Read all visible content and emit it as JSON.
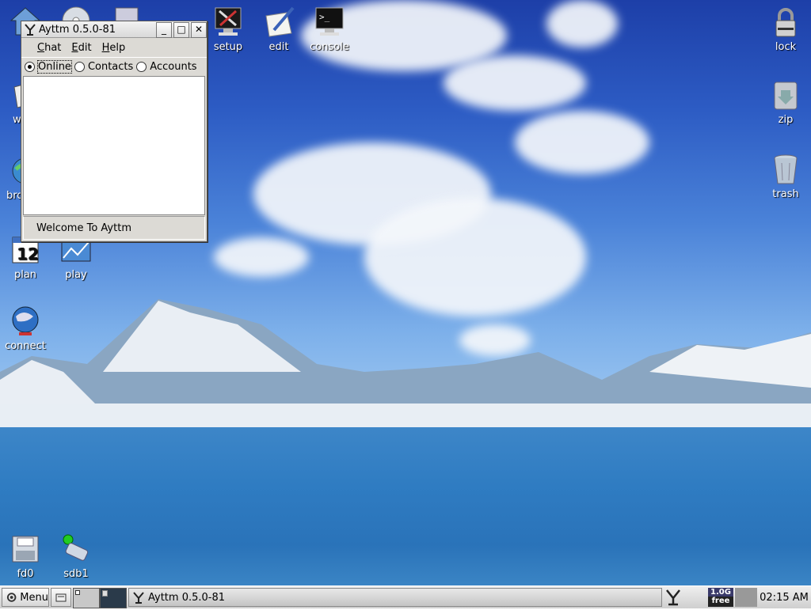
{
  "desktop": {
    "icons_top": [
      {
        "label": "setup",
        "icon": "setup-tools-icon"
      },
      {
        "label": "edit",
        "icon": "edit-pen-icon"
      },
      {
        "label": "console",
        "icon": "console-terminal-icon"
      }
    ],
    "icons_left": [
      {
        "label": "w",
        "icon": "writer-icon"
      },
      {
        "label": "bro",
        "icon": "browser-icon"
      },
      {
        "label": "plan",
        "icon": "calendar-icon",
        "badge": "12"
      },
      {
        "label": "play",
        "icon": "media-player-icon"
      },
      {
        "label": "connect",
        "icon": "network-globe-icon"
      }
    ],
    "icons_right": [
      {
        "label": "lock",
        "icon": "padlock-icon"
      },
      {
        "label": "zip",
        "icon": "archive-icon"
      },
      {
        "label": "trash",
        "icon": "trash-bin-icon"
      }
    ],
    "icons_bottom": [
      {
        "label": "fd0",
        "icon": "floppy-drive-icon"
      },
      {
        "label": "sdb1",
        "icon": "usb-drive-icon"
      }
    ]
  },
  "window": {
    "title": "Ayttm 0.5.0-81",
    "menu": [
      "Chat",
      "Edit",
      "Help"
    ],
    "tabs": [
      {
        "label": "Online",
        "selected": true
      },
      {
        "label": "Contacts",
        "selected": false
      },
      {
        "label": "Accounts",
        "selected": false
      }
    ],
    "status": "Welcome To Ayttm"
  },
  "taskbar": {
    "menu_label": "Menu",
    "task_label": "Ayttm 0.5.0-81",
    "disk_top": "1.0G",
    "disk_bottom": "free",
    "clock": "02:15 AM"
  },
  "colors": {
    "sky_top": "#1d3fa8",
    "water": "#2f7cc2",
    "window_bg": "#dcdad5"
  }
}
